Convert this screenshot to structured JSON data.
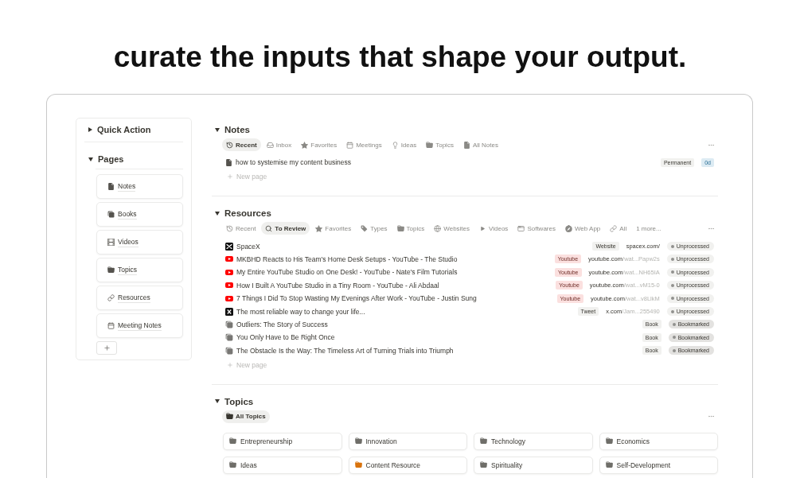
{
  "headline": "curate the inputs that shape your output.",
  "sidebar": {
    "sections": [
      {
        "title": "Quick Action",
        "expanded": false
      },
      {
        "title": "Pages",
        "expanded": true,
        "pages": [
          {
            "label": "Notes",
            "kind": "file"
          },
          {
            "label": "Books",
            "kind": "books"
          },
          {
            "label": "Videos",
            "kind": "film"
          },
          {
            "label": "Topics",
            "kind": "folder"
          },
          {
            "label": "Resources",
            "kind": "link"
          },
          {
            "label": "Meeting Notes",
            "kind": "calendar"
          }
        ]
      }
    ]
  },
  "sections": [
    {
      "kind": "list",
      "title": "Notes",
      "expanded": true,
      "tabs": [
        {
          "label": "Recent",
          "kind": "history",
          "selected": true
        },
        {
          "label": "Inbox",
          "kind": "tray",
          "selected": false
        },
        {
          "label": "Favorites",
          "kind": "star",
          "selected": false
        },
        {
          "label": "Meetings",
          "kind": "calendar",
          "selected": false
        },
        {
          "label": "Ideas",
          "kind": "bulb",
          "selected": false
        },
        {
          "label": "Topics",
          "kind": "folder",
          "selected": false
        },
        {
          "label": "All Notes",
          "kind": "file",
          "selected": false
        }
      ],
      "rows": [
        {
          "kind": "note",
          "title": "how to systemise my content business",
          "tags": [
            {
              "label": "Permanent",
              "color": "#f1f1ef"
            },
            {
              "label": "0d",
              "color": "#dcebf3"
            }
          ]
        }
      ],
      "new_page": "New page"
    },
    {
      "kind": "list",
      "title": "Resources",
      "expanded": true,
      "tabs": [
        {
          "label": "Recent",
          "kind": "history",
          "selected": false
        },
        {
          "label": "To Review",
          "kind": "search",
          "selected": true
        },
        {
          "label": "Favorites",
          "kind": "star",
          "selected": false
        },
        {
          "label": "Types",
          "kind": "tag",
          "selected": false
        },
        {
          "label": "Topics",
          "kind": "folder",
          "selected": false
        },
        {
          "label": "Websites",
          "kind": "globe",
          "selected": false
        },
        {
          "label": "Videos",
          "kind": "play",
          "selected": false
        },
        {
          "label": "Softwares",
          "kind": "window",
          "selected": false
        },
        {
          "label": "Web App",
          "kind": "compass",
          "selected": false
        },
        {
          "label": "All",
          "kind": "link",
          "selected": false
        },
        {
          "label": "1 more...",
          "kind": "plain",
          "selected": false
        }
      ],
      "rows": [
        {
          "kind": "site",
          "title": "SpaceX",
          "tags": [
            {
              "label": "Website",
              "color": "#f1f1ef"
            }
          ],
          "url": {
            "domain": "spacex.com/"
          },
          "status": {
            "label": "Unprocessed",
            "color": "#f1f1ef"
          }
        },
        {
          "kind": "video",
          "title": "MKBHD Reacts to His Team's Home Desk Setups - YouTube - The Studio",
          "tags": [
            {
              "label": "Youtube",
              "color": "#fbe0df"
            }
          ],
          "url": {
            "domain": "youtube.com",
            "path": "/wat...Papw2s"
          },
          "status": {
            "label": "Unprocessed",
            "color": "#f1f1ef"
          }
        },
        {
          "kind": "video",
          "title": "My Entire YouTube Studio on One Desk! - YouTube - Nate's Film Tutorials",
          "tags": [
            {
              "label": "Youtube",
              "color": "#fbe0df"
            }
          ],
          "url": {
            "domain": "youtube.com",
            "path": "/wat...NH65IA"
          },
          "status": {
            "label": "Unprocessed",
            "color": "#f1f1ef"
          }
        },
        {
          "kind": "video",
          "title": "How I Built A YouTube Studio in a Tiny Room - YouTube - Ali Abdaal",
          "tags": [
            {
              "label": "Youtube",
              "color": "#fbe0df"
            }
          ],
          "url": {
            "domain": "youtube.com",
            "path": "/wat...vM15-0"
          },
          "status": {
            "label": "Unprocessed",
            "color": "#f1f1ef"
          }
        },
        {
          "kind": "video",
          "title": "7 Things I Did To Stop Wasting My Evenings After Work - YouTube - Justin Sung",
          "tags": [
            {
              "label": "Youtube",
              "color": "#fbe0df"
            }
          ],
          "url": {
            "domain": "youtube.com",
            "path": "/wat...v8LlkM"
          },
          "status": {
            "label": "Unprocessed",
            "color": "#f1f1ef"
          }
        },
        {
          "kind": "post",
          "title": "The most reliable way to change your life...",
          "tags": [
            {
              "label": "Tweet",
              "color": "#f1f1ef"
            }
          ],
          "url": {
            "domain": "x.com",
            "path": "/Jam...255490"
          },
          "status": {
            "label": "Unprocessed",
            "color": "#f1f1ef"
          }
        },
        {
          "kind": "book",
          "title": "Outliers: The Story of Success",
          "tags": [
            {
              "label": "Book",
              "color": "#f1f1ef"
            }
          ],
          "status": {
            "label": "Bookmarked",
            "color": "#e3e2e0"
          }
        },
        {
          "kind": "book",
          "title": "You Only Have to Be Right Once",
          "tags": [
            {
              "label": "Book",
              "color": "#f1f1ef"
            }
          ],
          "status": {
            "label": "Bookmarked",
            "color": "#e3e2e0"
          }
        },
        {
          "kind": "book",
          "title": "The Obstacle Is the Way: The Timeless Art of Turning Trials into Triumph",
          "tags": [
            {
              "label": "Book",
              "color": "#f1f1ef"
            }
          ],
          "status": {
            "label": "Bookmarked",
            "color": "#e3e2e0"
          }
        }
      ],
      "new_page": "New page"
    },
    {
      "kind": "gallery",
      "title": "Topics",
      "expanded": true,
      "tabs": [
        {
          "label": "All Topics",
          "kind": "folder",
          "selected": true
        }
      ],
      "cards": [
        {
          "label": "Entrepreneurship",
          "color": "#6f6e69"
        },
        {
          "label": "Innovation",
          "color": "#6f6e69"
        },
        {
          "label": "Technology",
          "color": "#6f6e69"
        },
        {
          "label": "Economics",
          "color": "#6f6e69"
        },
        {
          "label": "Ideas",
          "color": "#6f6e69"
        },
        {
          "label": "Content Resource",
          "color": "#d9730d"
        },
        {
          "label": "Spirituality",
          "color": "#6f6e69"
        },
        {
          "label": "Self-Development",
          "color": "#6f6e69"
        }
      ]
    }
  ]
}
